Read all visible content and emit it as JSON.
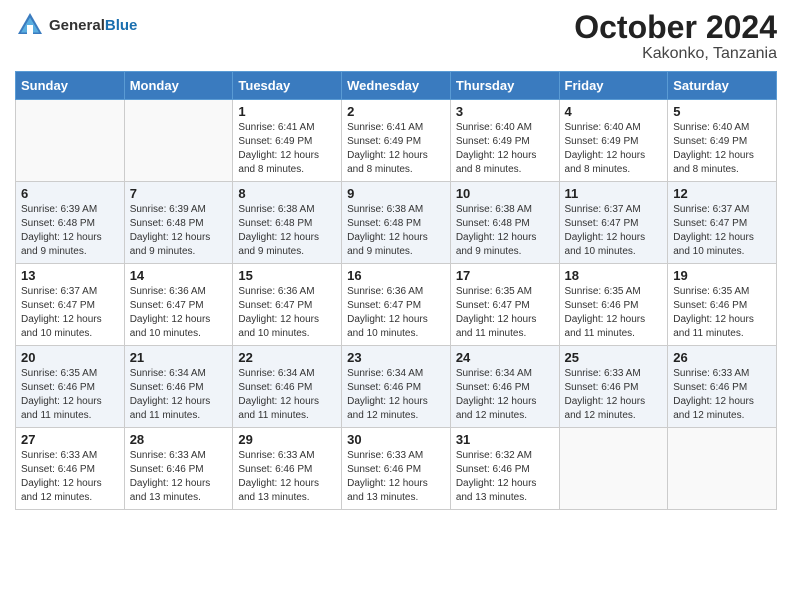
{
  "header": {
    "logo_general": "General",
    "logo_blue": "Blue",
    "title": "October 2024",
    "subtitle": "Kakonko, Tanzania"
  },
  "calendar": {
    "days_of_week": [
      "Sunday",
      "Monday",
      "Tuesday",
      "Wednesday",
      "Thursday",
      "Friday",
      "Saturday"
    ],
    "weeks": [
      [
        {
          "day": "",
          "info": ""
        },
        {
          "day": "",
          "info": ""
        },
        {
          "day": "1",
          "info": "Sunrise: 6:41 AM\nSunset: 6:49 PM\nDaylight: 12 hours and 8 minutes."
        },
        {
          "day": "2",
          "info": "Sunrise: 6:41 AM\nSunset: 6:49 PM\nDaylight: 12 hours and 8 minutes."
        },
        {
          "day": "3",
          "info": "Sunrise: 6:40 AM\nSunset: 6:49 PM\nDaylight: 12 hours and 8 minutes."
        },
        {
          "day": "4",
          "info": "Sunrise: 6:40 AM\nSunset: 6:49 PM\nDaylight: 12 hours and 8 minutes."
        },
        {
          "day": "5",
          "info": "Sunrise: 6:40 AM\nSunset: 6:49 PM\nDaylight: 12 hours and 8 minutes."
        }
      ],
      [
        {
          "day": "6",
          "info": "Sunrise: 6:39 AM\nSunset: 6:48 PM\nDaylight: 12 hours and 9 minutes."
        },
        {
          "day": "7",
          "info": "Sunrise: 6:39 AM\nSunset: 6:48 PM\nDaylight: 12 hours and 9 minutes."
        },
        {
          "day": "8",
          "info": "Sunrise: 6:38 AM\nSunset: 6:48 PM\nDaylight: 12 hours and 9 minutes."
        },
        {
          "day": "9",
          "info": "Sunrise: 6:38 AM\nSunset: 6:48 PM\nDaylight: 12 hours and 9 minutes."
        },
        {
          "day": "10",
          "info": "Sunrise: 6:38 AM\nSunset: 6:48 PM\nDaylight: 12 hours and 9 minutes."
        },
        {
          "day": "11",
          "info": "Sunrise: 6:37 AM\nSunset: 6:47 PM\nDaylight: 12 hours and 10 minutes."
        },
        {
          "day": "12",
          "info": "Sunrise: 6:37 AM\nSunset: 6:47 PM\nDaylight: 12 hours and 10 minutes."
        }
      ],
      [
        {
          "day": "13",
          "info": "Sunrise: 6:37 AM\nSunset: 6:47 PM\nDaylight: 12 hours and 10 minutes."
        },
        {
          "day": "14",
          "info": "Sunrise: 6:36 AM\nSunset: 6:47 PM\nDaylight: 12 hours and 10 minutes."
        },
        {
          "day": "15",
          "info": "Sunrise: 6:36 AM\nSunset: 6:47 PM\nDaylight: 12 hours and 10 minutes."
        },
        {
          "day": "16",
          "info": "Sunrise: 6:36 AM\nSunset: 6:47 PM\nDaylight: 12 hours and 10 minutes."
        },
        {
          "day": "17",
          "info": "Sunrise: 6:35 AM\nSunset: 6:47 PM\nDaylight: 12 hours and 11 minutes."
        },
        {
          "day": "18",
          "info": "Sunrise: 6:35 AM\nSunset: 6:46 PM\nDaylight: 12 hours and 11 minutes."
        },
        {
          "day": "19",
          "info": "Sunrise: 6:35 AM\nSunset: 6:46 PM\nDaylight: 12 hours and 11 minutes."
        }
      ],
      [
        {
          "day": "20",
          "info": "Sunrise: 6:35 AM\nSunset: 6:46 PM\nDaylight: 12 hours and 11 minutes."
        },
        {
          "day": "21",
          "info": "Sunrise: 6:34 AM\nSunset: 6:46 PM\nDaylight: 12 hours and 11 minutes."
        },
        {
          "day": "22",
          "info": "Sunrise: 6:34 AM\nSunset: 6:46 PM\nDaylight: 12 hours and 11 minutes."
        },
        {
          "day": "23",
          "info": "Sunrise: 6:34 AM\nSunset: 6:46 PM\nDaylight: 12 hours and 12 minutes."
        },
        {
          "day": "24",
          "info": "Sunrise: 6:34 AM\nSunset: 6:46 PM\nDaylight: 12 hours and 12 minutes."
        },
        {
          "day": "25",
          "info": "Sunrise: 6:33 AM\nSunset: 6:46 PM\nDaylight: 12 hours and 12 minutes."
        },
        {
          "day": "26",
          "info": "Sunrise: 6:33 AM\nSunset: 6:46 PM\nDaylight: 12 hours and 12 minutes."
        }
      ],
      [
        {
          "day": "27",
          "info": "Sunrise: 6:33 AM\nSunset: 6:46 PM\nDaylight: 12 hours and 12 minutes."
        },
        {
          "day": "28",
          "info": "Sunrise: 6:33 AM\nSunset: 6:46 PM\nDaylight: 12 hours and 13 minutes."
        },
        {
          "day": "29",
          "info": "Sunrise: 6:33 AM\nSunset: 6:46 PM\nDaylight: 12 hours and 13 minutes."
        },
        {
          "day": "30",
          "info": "Sunrise: 6:33 AM\nSunset: 6:46 PM\nDaylight: 12 hours and 13 minutes."
        },
        {
          "day": "31",
          "info": "Sunrise: 6:32 AM\nSunset: 6:46 PM\nDaylight: 12 hours and 13 minutes."
        },
        {
          "day": "",
          "info": ""
        },
        {
          "day": "",
          "info": ""
        }
      ]
    ]
  }
}
